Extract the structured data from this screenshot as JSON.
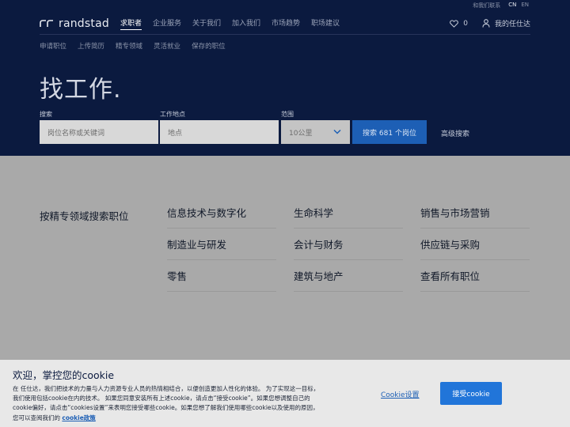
{
  "top_links": {
    "site_link": "和我们联系",
    "lang_cn": "CN",
    "lang_en": "EN"
  },
  "brand": {
    "name": "randstad"
  },
  "main_nav": {
    "items": [
      "求职者",
      "企业服务",
      "关于我们",
      "加入我们",
      "市场趋势",
      "职场建议"
    ],
    "favorites_count": "0",
    "account_label": "我的任仕达"
  },
  "sub_nav": {
    "items": [
      "申请职位",
      "上传简历",
      "精专领域",
      "灵活就业",
      "保存的职位"
    ]
  },
  "hero": {
    "title": "找工作."
  },
  "search": {
    "keyword_label": "搜索",
    "keyword_placeholder": "岗位名称或关键词",
    "location_label": "工作地点",
    "location_placeholder": "地点",
    "range_label": "范围",
    "range_value": "10公里",
    "button_label": "搜索 681 个岗位",
    "advanced_label": "高级搜索"
  },
  "specialities": {
    "title": "按精专领域搜索职位",
    "columns": [
      [
        "信息技术与数字化",
        "制造业与研发",
        "零售"
      ],
      [
        "生命科学",
        "会计与财务",
        "建筑与地产"
      ],
      [
        "销售与市场营销",
        "供应链与采购",
        "查看所有职位"
      ]
    ]
  },
  "cookie": {
    "title": "欢迎，掌控您的cookie",
    "body": "在 任仕达，我们把技术的力量与人力资源专业人员的热情相结合，以便创造更加人性化的体验。 为了实现这一目标，我们使用包括cookie在内的技术。 如果您同意安装所有上述cookie，请点击“接受cookie”。如果您想调整自己的cookie偏好，请点击“cookies设置”来表明您接受哪些cookie。如果您想了解我们使用哪些cookie以及使用的原因，您可以查阅我们的 ",
    "policy_link": "cookie政策",
    "settings_label": "Cookie设置",
    "accept_label": "接受cookie"
  },
  "colors": {
    "hero_bg": "#0b1a3f",
    "accent_blue": "#1d5fb5",
    "accept_blue": "#2175d9",
    "overlay_gray": "#a9a9a9",
    "cookie_bg": "#e8e8e8"
  }
}
